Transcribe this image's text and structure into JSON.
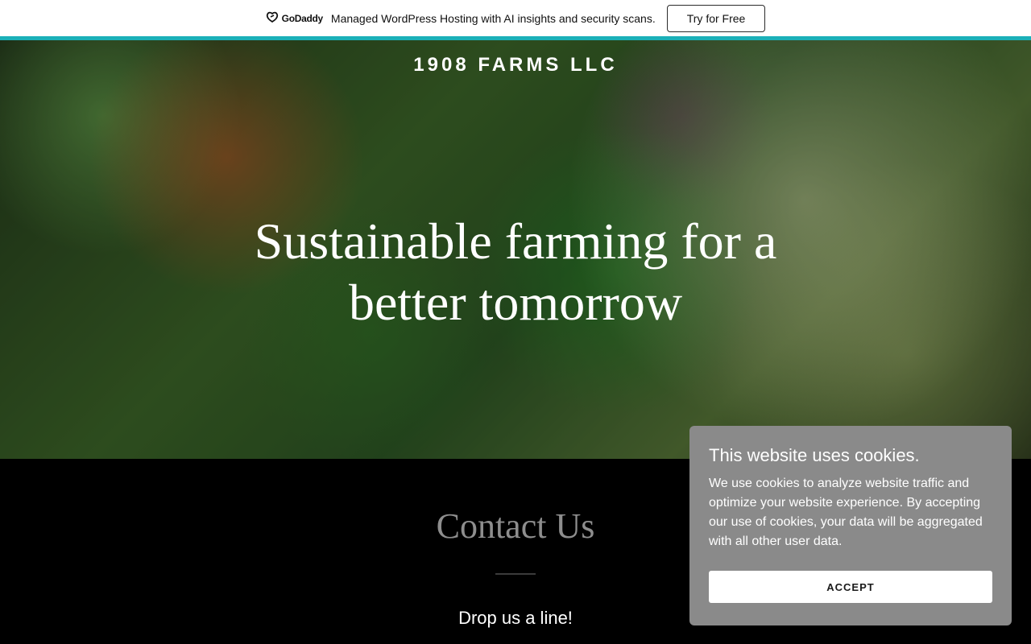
{
  "promo": {
    "logo_text": "GoDaddy",
    "message": "Managed WordPress Hosting with AI insights and security scans.",
    "cta_label": "Try for Free",
    "accent_color": "#1bb0b8"
  },
  "hero": {
    "brand": "1908 FARMS LLC",
    "headline": "Sustainable farming for a better tomorrow"
  },
  "contact": {
    "title": "Contact Us",
    "subtitle": "Drop us a line!"
  },
  "cookie_banner": {
    "title": "This website uses cookies.",
    "body": "We use cookies to analyze website traffic and optimize your website experience. By accepting our use of cookies, your data will be aggregated with all other user data.",
    "accept_label": "ACCEPT"
  }
}
